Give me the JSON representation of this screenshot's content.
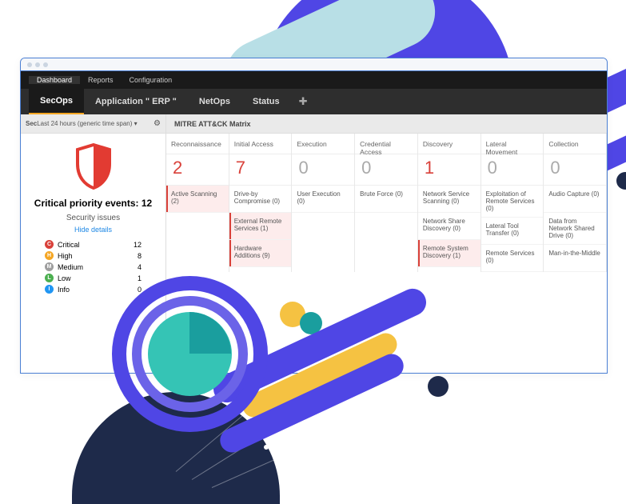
{
  "topnav": {
    "items": [
      "Dashboard",
      "Reports",
      "Configuration"
    ],
    "active": 0
  },
  "subnav": {
    "tabs": [
      "SecOps",
      "Application \" ERP \"",
      "NetOps",
      "Status"
    ],
    "active": 0
  },
  "sidebar": {
    "timespan_prefix": "Sec",
    "timespan_label": "Last 24 hours (generic time span)",
    "critical_title": "Critical priority events: 12",
    "security_issues": "Security issues",
    "hide_details": "Hide details",
    "severities": [
      {
        "badge": "C",
        "label": "Critical",
        "count": 12,
        "color": "#d9413a"
      },
      {
        "badge": "H",
        "label": "High",
        "count": 8,
        "color": "#f5a623"
      },
      {
        "badge": "M",
        "label": "Medium",
        "count": 4,
        "color": "#9e9e9e"
      },
      {
        "badge": "L",
        "label": "Low",
        "count": 1,
        "color": "#4caf50"
      },
      {
        "badge": "I",
        "label": "Info",
        "count": 0,
        "color": "#2196f3"
      }
    ]
  },
  "mitre": {
    "title": "MITRE ATT&CK Matrix",
    "columns": [
      {
        "name": "Reconnaissance",
        "count": 2,
        "red": true,
        "cells": [
          {
            "t": "Active Scanning (2)",
            "hl": true
          }
        ]
      },
      {
        "name": "Initial Access",
        "count": 7,
        "red": true,
        "cells": [
          {
            "t": "Drive-by Compromise (0)"
          },
          {
            "t": "External Remote Services (1)",
            "hl": true
          },
          {
            "t": "Hardware Additions (9)",
            "hl": true
          }
        ]
      },
      {
        "name": "Execution",
        "count": 0,
        "red": false,
        "cells": [
          {
            "t": "User Execution (0)"
          }
        ]
      },
      {
        "name": "Credential Access",
        "count": 0,
        "red": false,
        "cells": [
          {
            "t": "Brute Force (0)"
          }
        ]
      },
      {
        "name": "Discovery",
        "count": 1,
        "red": true,
        "cells": [
          {
            "t": "Network Service Scanning (0)"
          },
          {
            "t": "Network Share Discovery (0)"
          },
          {
            "t": "Remote System Discovery (1)",
            "hl": true
          }
        ]
      },
      {
        "name": "Lateral Movement",
        "count": 0,
        "red": false,
        "cells": [
          {
            "t": "Exploitation of Remote Services (0)"
          },
          {
            "t": "Lateral Tool Transfer (0)"
          },
          {
            "t": "Remote Services (0)"
          }
        ]
      },
      {
        "name": "Collection",
        "count": 0,
        "red": false,
        "cells": [
          {
            "t": "Audio Capture (0)"
          },
          {
            "t": "Data from Network Shared Drive (0)"
          },
          {
            "t": "Man-in-the-Middle"
          }
        ]
      }
    ]
  }
}
